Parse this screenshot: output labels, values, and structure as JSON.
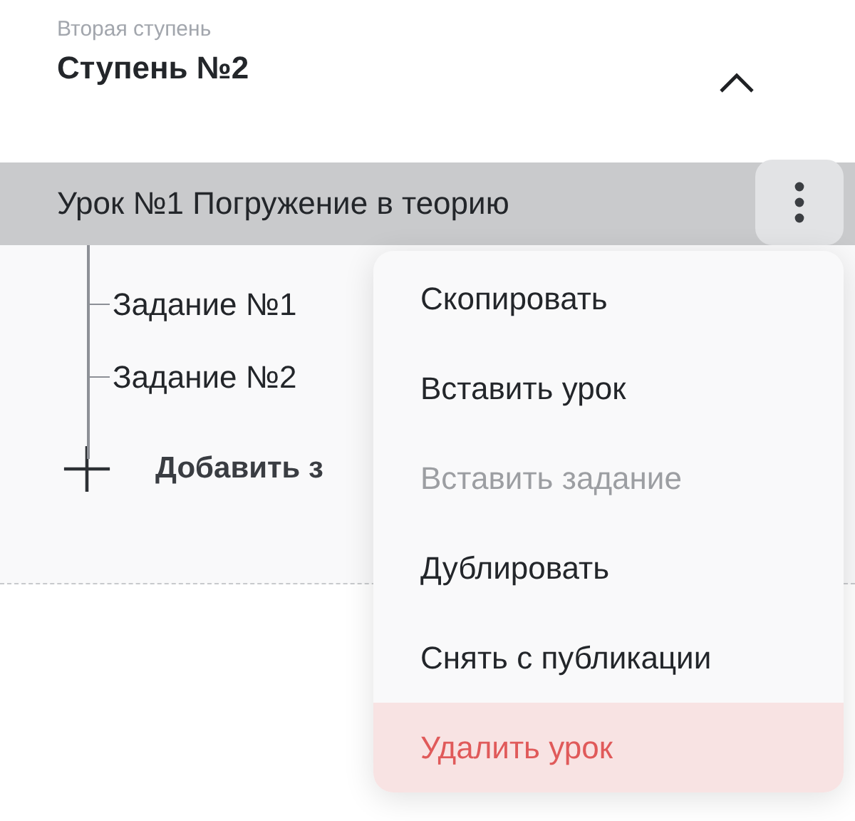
{
  "section": {
    "caption": "Вторая ступень",
    "title": "Ступень №2",
    "expanded": true
  },
  "lesson": {
    "title": "Урок №1 Погружение в теорию",
    "selected": true,
    "children": [
      {
        "title": "Задание №1"
      },
      {
        "title": "Задание №2"
      }
    ],
    "add_label": "Добавить з"
  },
  "menu": [
    {
      "label": "Скопировать",
      "kind": "normal",
      "disabled": false
    },
    {
      "label": "Вставить урок",
      "kind": "normal",
      "disabled": false
    },
    {
      "label": "Вставить задание",
      "kind": "normal",
      "disabled": true
    },
    {
      "label": "Дублировать",
      "kind": "normal",
      "disabled": false
    },
    {
      "label": "Снять с публикации",
      "kind": "normal",
      "disabled": false
    },
    {
      "label": "Удалить урок",
      "kind": "danger",
      "disabled": false
    }
  ]
}
